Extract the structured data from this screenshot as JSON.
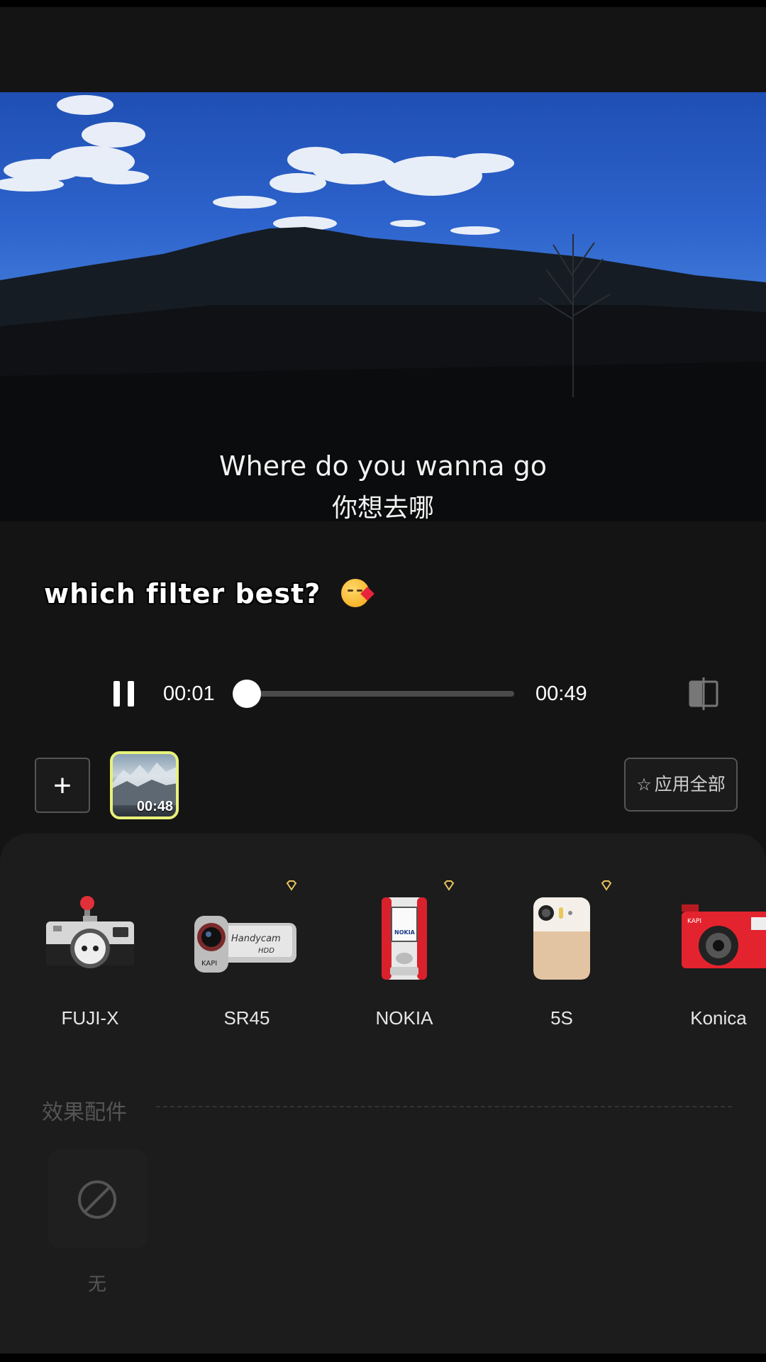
{
  "video": {
    "subtitle_en": "Where do you wanna go",
    "subtitle_zh": "你想去哪"
  },
  "caption": {
    "text": "which filter best?",
    "emoji": "kissing-face-emoji"
  },
  "player": {
    "state": "playing",
    "current_time": "00:01",
    "total_time": "00:49",
    "progress": 0.02
  },
  "clips": {
    "add_label": "+",
    "items": [
      {
        "duration": "00:48",
        "selected": true
      }
    ],
    "apply_all_label": "应用全部"
  },
  "filters": [
    {
      "name": "FUJI-X",
      "vip": false
    },
    {
      "name": "SR45",
      "vip": true
    },
    {
      "name": "NOKIA",
      "vip": true
    },
    {
      "name": "5S",
      "vip": true
    },
    {
      "name": "Konica",
      "vip": false
    }
  ],
  "accessories": {
    "title": "效果配件",
    "none_label": "无"
  },
  "colors": {
    "background": "#141414",
    "panel": "#1c1c1c",
    "clip_highlight": "#e8f07a",
    "vip_gold": "#e8c25a"
  }
}
